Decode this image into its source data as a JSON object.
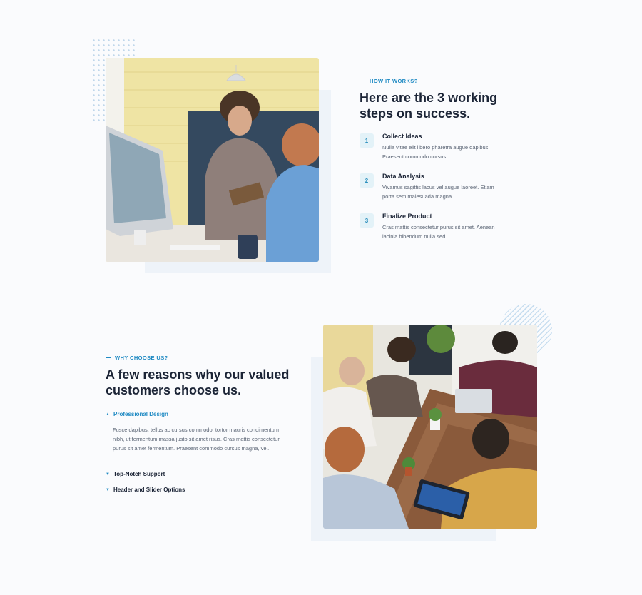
{
  "section1": {
    "eyebrow": "HOW IT WORKS?",
    "heading_line1": "Here are the 3 working",
    "heading_line2": "steps on success.",
    "steps": [
      {
        "num": "1",
        "title": "Collect Ideas",
        "text": "Nulla vitae elit libero pharetra augue dapibus. Praesent commodo cursus."
      },
      {
        "num": "2",
        "title": "Data Analysis",
        "text": "Vivamus sagittis lacus vel augue laoreet. Etiam porta sem malesuada magna."
      },
      {
        "num": "3",
        "title": "Finalize Product",
        "text": "Cras mattis consectetur purus sit amet. Aenean lacinia bibendum nulla sed."
      }
    ]
  },
  "section2": {
    "eyebrow": "WHY CHOOSE US?",
    "heading_line1": "A few reasons why our valued",
    "heading_line2": "customers choose us.",
    "accordion": [
      {
        "title": "Professional Design",
        "open": true,
        "body": "Fusce dapibus, tellus ac cursus commodo, tortor mauris condimentum nibh, ut fermentum massa justo sit amet risus. Cras mattis consectetur purus sit amet fermentum. Praesent commodo cursus magna, vel."
      },
      {
        "title": "Top-Notch Support",
        "open": false
      },
      {
        "title": "Header and Slider Options",
        "open": false
      }
    ]
  },
  "colors": {
    "accent": "#1f8ac3",
    "heading": "#1b2436",
    "body": "#5b6575"
  }
}
